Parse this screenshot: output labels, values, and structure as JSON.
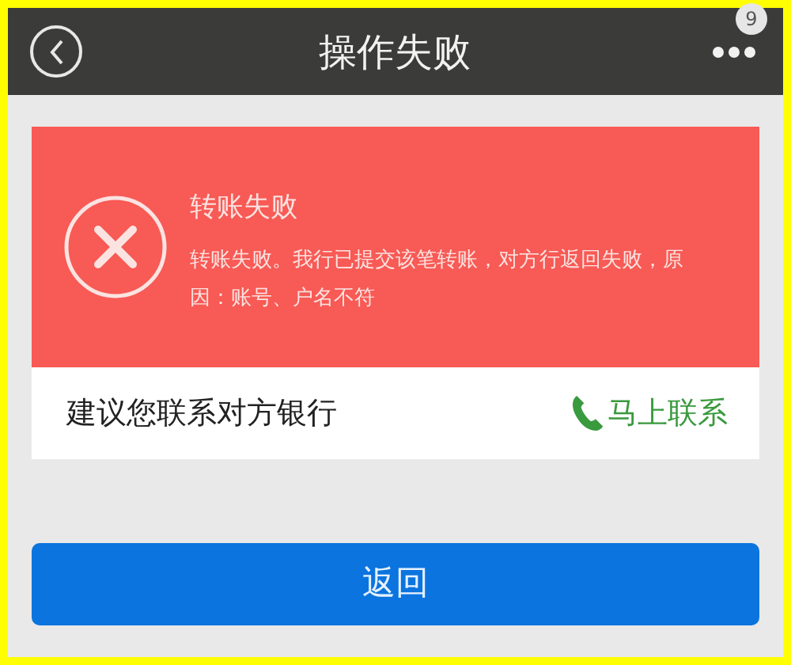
{
  "header": {
    "title": "操作失败",
    "badge": "9"
  },
  "result": {
    "title": "转账失败",
    "message": "转账失败。我行已提交该笔转账，对方行返回失败，原因：账号、户名不符"
  },
  "contact": {
    "text": "建议您联系对方银行",
    "action": "马上联系"
  },
  "button": {
    "label": "返回"
  }
}
